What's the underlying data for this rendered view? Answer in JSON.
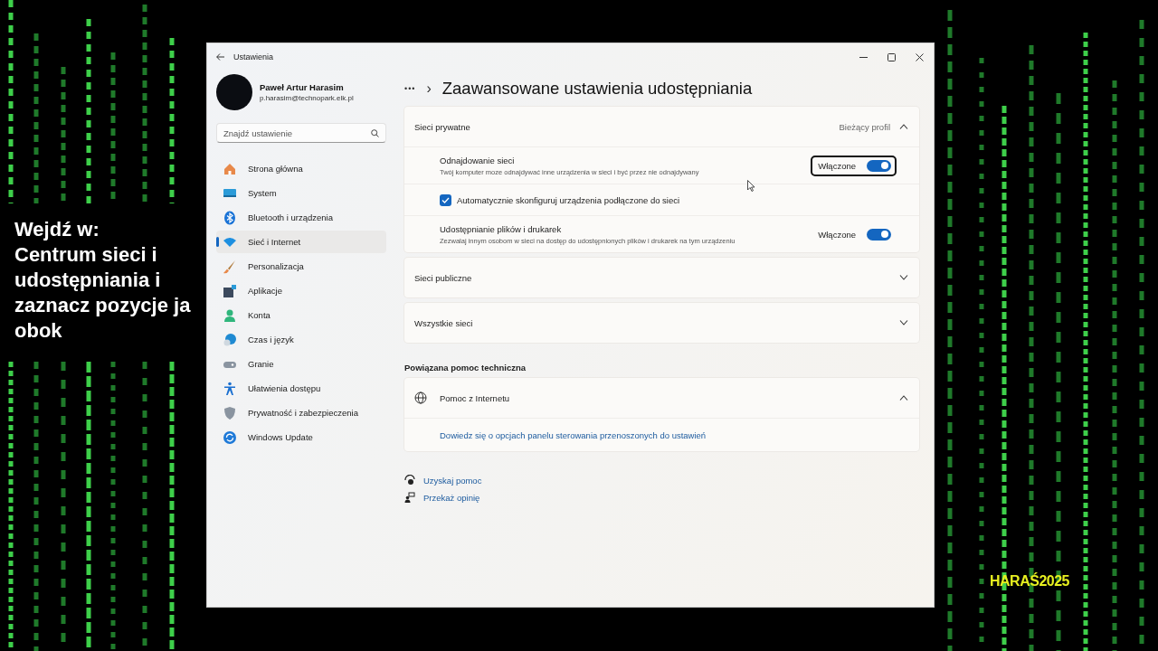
{
  "caption": "Wejdź w:\nCentrum sieci i\nudostępniania i\nzaznacz pozycje ja\nobok",
  "badge": "HARAŚ2025",
  "window": {
    "title": "Ustawienia"
  },
  "profile": {
    "name": "Paweł Artur Harasim",
    "email": "p.harasim@technopark.elk.pl"
  },
  "search": {
    "placeholder": "Znajdź ustawienie"
  },
  "nav": [
    {
      "label": "Strona główna",
      "selected": false
    },
    {
      "label": "System",
      "selected": false
    },
    {
      "label": "Bluetooth i urządzenia",
      "selected": false
    },
    {
      "label": "Sieć i Internet",
      "selected": true
    },
    {
      "label": "Personalizacja",
      "selected": false
    },
    {
      "label": "Aplikacje",
      "selected": false
    },
    {
      "label": "Konta",
      "selected": false
    },
    {
      "label": "Czas i język",
      "selected": false
    },
    {
      "label": "Granie",
      "selected": false
    },
    {
      "label": "Ułatwienia dostępu",
      "selected": false
    },
    {
      "label": "Prywatność i zabezpieczenia",
      "selected": false
    },
    {
      "label": "Windows Update",
      "selected": false
    }
  ],
  "breadcrumb": {
    "more": "•••",
    "separator": "›"
  },
  "page_title": "Zaawansowane ustawienia udostępniania",
  "sections": [
    {
      "title": "Sieci prywatne",
      "note": "Bieżący profil",
      "expanded": true,
      "rows": [
        {
          "kind": "toggle",
          "title": "Odnajdowanie sieci",
          "description": "Twój komputer moze odnajdywać inne urządzenia w sieci i być przez nie odnajdywany",
          "state_label": "Włączone",
          "on": true,
          "focused": true
        },
        {
          "kind": "checkbox",
          "label": "Automatycznie skonfiguruj urządzenia podłączone do sieci",
          "checked": true
        },
        {
          "kind": "toggle",
          "title": "Udostępnianie plików i drukarek",
          "description": "Zezwalaj innym osobom w sieci na dostęp do udostępnionych plików i drukarek na tym urządzeniu",
          "state_label": "Włączone",
          "on": true,
          "focused": false
        }
      ]
    },
    {
      "title": "Sieci publiczne",
      "expanded": false
    },
    {
      "title": "Wszystkie sieci",
      "expanded": false
    }
  ],
  "related": {
    "heading": "Powiązana pomoc techniczna",
    "cards": [
      {
        "title": "Pomoc z Internetu",
        "expanded": true,
        "links": [
          "Dowiedz się o opcjach panelu sterowania przenoszonych do ustawień"
        ]
      }
    ]
  },
  "footer_links": [
    "Uzyskaj pomoc",
    "Przekaż opinię"
  ]
}
